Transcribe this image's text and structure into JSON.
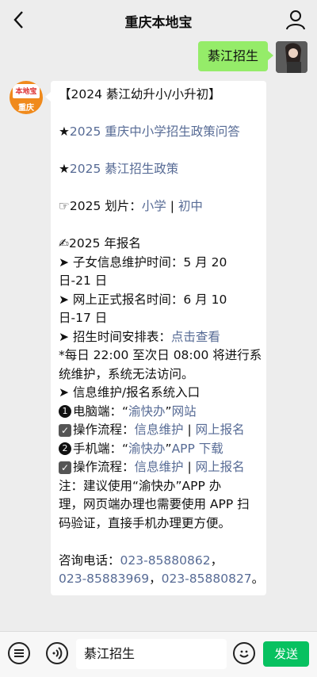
{
  "header": {
    "title": "重庆本地宝"
  },
  "sent_message": {
    "text": "綦江招生"
  },
  "bot": {
    "logo": "本地宝",
    "city": "重庆"
  },
  "message_lines": [
    {
      "parts": [
        {
          "t": "【2024 綦江幼升小/小升初】"
        }
      ]
    },
    {
      "blank": true
    },
    {
      "parts": [
        {
          "t": "★"
        },
        {
          "t": "2025 重庆中小学招生政策问答",
          "link": true
        }
      ]
    },
    {
      "blank": true
    },
    {
      "parts": [
        {
          "t": "★"
        },
        {
          "t": "2025 綦江招生政策",
          "link": true
        }
      ]
    },
    {
      "blank": true
    },
    {
      "parts": [
        {
          "t": "☞2025 划片："
        },
        {
          "t": "小学",
          "link": true
        },
        {
          "t": " | "
        },
        {
          "t": "初中",
          "link": true
        }
      ]
    },
    {
      "blank": true
    },
    {
      "parts": [
        {
          "t": "✍2025 年报名"
        }
      ]
    },
    {
      "parts": [
        {
          "t": "➤ 子女信息维护时间：5 月 20"
        }
      ]
    },
    {
      "parts": [
        {
          "t": "日-21 日"
        }
      ]
    },
    {
      "parts": [
        {
          "t": "➤ 网上正式报名时间：6 月 10"
        }
      ]
    },
    {
      "parts": [
        {
          "t": "日-17 日"
        }
      ]
    },
    {
      "parts": [
        {
          "t": "➤ 招生时间安排表："
        },
        {
          "t": "点击查看",
          "link": true
        }
      ]
    },
    {
      "parts": [
        {
          "t": "*每日 22:00 至次日 08:00 将进行系"
        }
      ]
    },
    {
      "parts": [
        {
          "t": "统维护，系统无法访问。"
        }
      ]
    },
    {
      "parts": [
        {
          "t": "➤ 信息维护/报名系统入口"
        }
      ]
    },
    {
      "parts": [
        {
          "num": "1"
        },
        {
          "t": "电脑端：“"
        },
        {
          "t": "渝快办",
          "link": true
        },
        {
          "t": "”"
        },
        {
          "t": "网站",
          "link": true
        }
      ]
    },
    {
      "parts": [
        {
          "check": true
        },
        {
          "t": "操作流程："
        },
        {
          "t": "信息维护",
          "link": true
        },
        {
          "t": " | "
        },
        {
          "t": "网上报名",
          "link": true
        }
      ]
    },
    {
      "parts": [
        {
          "num": "2"
        },
        {
          "t": "手机端：“"
        },
        {
          "t": "渝快办",
          "link": true
        },
        {
          "t": "”"
        },
        {
          "t": "APP 下载",
          "link": true
        }
      ]
    },
    {
      "parts": [
        {
          "check": true
        },
        {
          "t": "操作流程："
        },
        {
          "t": "信息维护",
          "link": true
        },
        {
          "t": " | "
        },
        {
          "t": "网上报名",
          "link": true
        }
      ]
    },
    {
      "parts": [
        {
          "t": "注：建议使用“渝快办”APP 办"
        }
      ]
    },
    {
      "parts": [
        {
          "t": "理，网页端办理也需要使用 APP 扫"
        }
      ]
    },
    {
      "parts": [
        {
          "t": "码验证，直接手机办理更方便。"
        }
      ]
    },
    {
      "blank": true
    },
    {
      "parts": [
        {
          "t": "咨询电话："
        },
        {
          "t": "023-85880862",
          "link": true
        },
        {
          "t": "，"
        }
      ]
    },
    {
      "parts": [
        {
          "t": "023-85883969",
          "link": true
        },
        {
          "t": "，"
        },
        {
          "t": "023-85880827",
          "link": true
        },
        {
          "t": "。"
        }
      ]
    }
  ],
  "input_bar": {
    "value": "綦江招生",
    "send_label": "发送"
  },
  "colors": {
    "link": "#576b95",
    "send": "#07c160",
    "sent_bubble": "#95ec69"
  }
}
